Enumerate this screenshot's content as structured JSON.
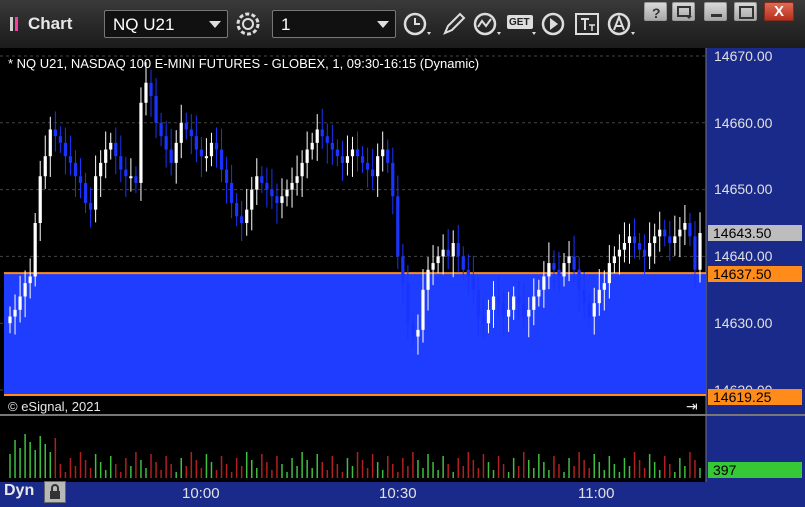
{
  "window": {
    "title": "Chart",
    "close_symbol": "X"
  },
  "toolbar": {
    "symbol": "NQ U21",
    "interval": "1",
    "get_label": "GET"
  },
  "chart": {
    "header": "* NQ U21, NASDAQ 100 E-MINI FUTURES - GLOBEX, 1, 09:30-16:15 (Dynamic)",
    "copyright": "© eSignal, 2021",
    "price_labels": [
      "14670.00",
      "14660.00",
      "14650.00",
      "14640.00",
      "14630.00",
      "14620.00"
    ],
    "last_price_tag": "14643.50",
    "upper_band_tag": "14637.50",
    "lower_band_tag": "14619.25",
    "volume_tag": "397",
    "time_labels": [
      "10:00",
      "10:30",
      "11:00"
    ],
    "mode_label": "Dyn",
    "colors": {
      "up": "#ffffff",
      "down": "#1a33ff",
      "band_fill": "#1f3dff",
      "band_line": "#ff8c1a",
      "vol_up": "#3fbf3f",
      "vol_down": "#b02020",
      "axis_bg": "#1a2a8a"
    }
  },
  "chart_data": {
    "type": "candlestick",
    "title": "* NQ U21, NASDAQ 100 E-MINI FUTURES - GLOBEX, 1, 09:30-16:15 (Dynamic)",
    "ylim": [
      14619,
      14670
    ],
    "y_ticks": [
      14620,
      14630,
      14640,
      14650,
      14660,
      14670
    ],
    "x_ticks": [
      "10:00",
      "10:30",
      "11:00"
    ],
    "last_price": 14643.5,
    "zone": [
      14619.25,
      14637.5
    ],
    "last_volume": 397,
    "close": [
      14631,
      14632,
      14634,
      14636,
      14637,
      14645,
      14652,
      14655,
      14659,
      14658,
      14657,
      14655,
      14654,
      14652,
      14651,
      14648,
      14647,
      14652,
      14654,
      14656,
      14657,
      14655,
      14653,
      14652,
      14652,
      14651,
      14663,
      14666,
      14664,
      14660,
      14658,
      14656,
      14654,
      14657,
      14660,
      14659,
      14658,
      14656,
      14655,
      14655,
      14657,
      14656,
      14653,
      14651,
      14648,
      14646,
      14645,
      14647,
      14650,
      14652,
      14651,
      14650,
      14649,
      14648,
      14649,
      14650,
      14651,
      14652,
      14654,
      14656,
      14657,
      14659,
      14658,
      14657,
      14656,
      14655,
      14654,
      14655,
      14656,
      14655,
      14654,
      14653,
      14652,
      14655,
      14656,
      14654,
      14649,
      14640,
      14636,
      14630,
      14628,
      14629,
      14635,
      14638,
      14639,
      14640,
      14641,
      14640,
      14642,
      14640,
      14638,
      14637,
      14635,
      14631,
      14630,
      14632,
      14634,
      14633,
      14631,
      14632,
      14634,
      14633,
      14631,
      14632,
      14634,
      14635,
      14637,
      14639,
      14638,
      14637,
      14639,
      14640,
      14638,
      14635,
      14633,
      14631,
      14633,
      14635,
      14636,
      14639,
      14640,
      14641,
      14642,
      14643,
      14642,
      14641,
      14640,
      14642,
      14643,
      14644,
      14643,
      14642,
      14643,
      14644,
      14645,
      14643,
      14638,
      14643.5
    ]
  }
}
